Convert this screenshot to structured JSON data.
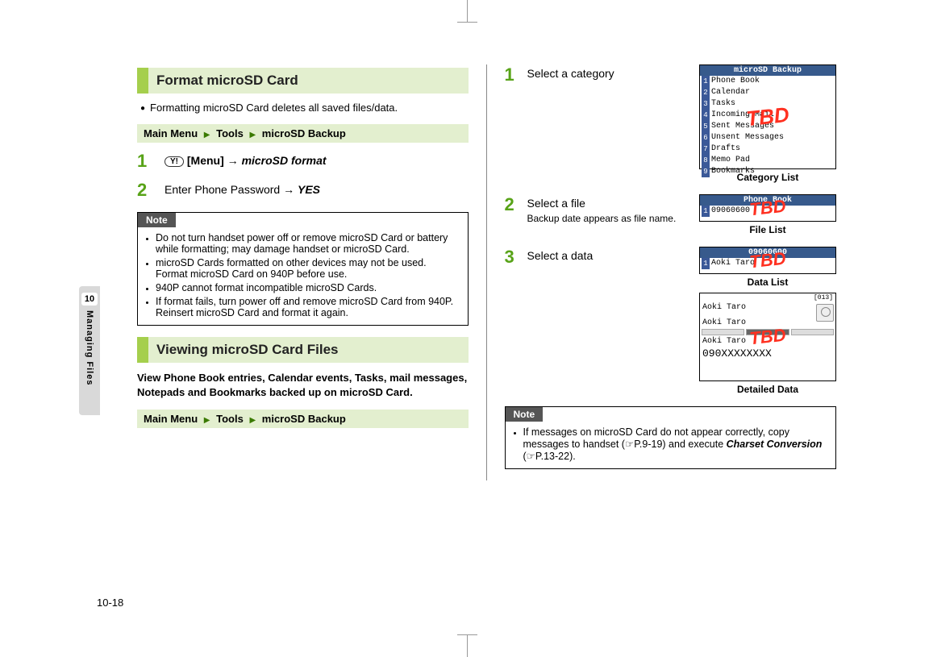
{
  "sidebar": {
    "chapter": "10",
    "label": "Managing Files"
  },
  "pageNumber": "10-18",
  "left": {
    "sec1": {
      "title": "Format microSD Card",
      "bullet": "Formatting microSD Card deletes all saved files/data.",
      "nav_main": "Main Menu",
      "nav_tools": "Tools",
      "nav_backup": "microSD Backup",
      "step1_key": "Y!",
      "step1_menu": "[Menu]",
      "step1_arrow": "→",
      "step1_action": "microSD format",
      "step2_prefix": "Enter Phone Password",
      "step2_arrow": "→",
      "step2_yes": "YES",
      "note_title": "Note",
      "note_items": [
        "Do not turn handset power off or remove microSD Card or battery while formatting; may damage handset or microSD Card.",
        "microSD Cards formatted on other devices may not be used. Format microSD Card on 940P before use.",
        "940P cannot format incompatible microSD Cards.",
        "If format fails, turn power off and remove microSD Card from 940P. Reinsert microSD Card and format it again."
      ]
    },
    "sec2": {
      "title": "Viewing microSD Card Files",
      "intro": "View Phone Book entries, Calendar events, Tasks, mail messages, Notepads and Bookmarks backed up on microSD Card.",
      "nav_main": "Main Menu",
      "nav_tools": "Tools",
      "nav_backup": "microSD Backup"
    }
  },
  "right": {
    "step1": {
      "text": "Select a category",
      "screen_title": "microSD Backup",
      "items": [
        "Phone Book",
        "Calendar",
        "Tasks",
        "Incoming Mail",
        "Sent Messages",
        "Unsent Messages",
        "Drafts",
        "Memo Pad",
        "Bookmarks"
      ],
      "tbd": "TBD",
      "caption": "Category List"
    },
    "step2": {
      "text": "Select a file",
      "sub": "Backup date appears as file name.",
      "screen_title": "Phone Book",
      "item": "09060600",
      "tbd": "TBD",
      "caption": "File List"
    },
    "step3": {
      "text": "Select a data",
      "screen_title": "09060600",
      "item": "Aoki Taro",
      "tbd": "TBD",
      "caption": "Data List"
    },
    "detail": {
      "counter": "[013]",
      "name1": "Aoki Taro",
      "name2": "Aoki Taro",
      "name3": "Aoki Taro",
      "phone": "090XXXXXXXX",
      "tbd": "TBD",
      "caption": "Detailed Data"
    },
    "note": {
      "title": "Note",
      "text_prefix": "If messages on microSD Card do not appear correctly, copy messages to handset (",
      "ref1": "P.9-19",
      "text_mid": ") and execute ",
      "charset": "Charset Conversion",
      "text_open2": " (",
      "ref2": "P.13-22",
      "text_end": ")."
    }
  }
}
